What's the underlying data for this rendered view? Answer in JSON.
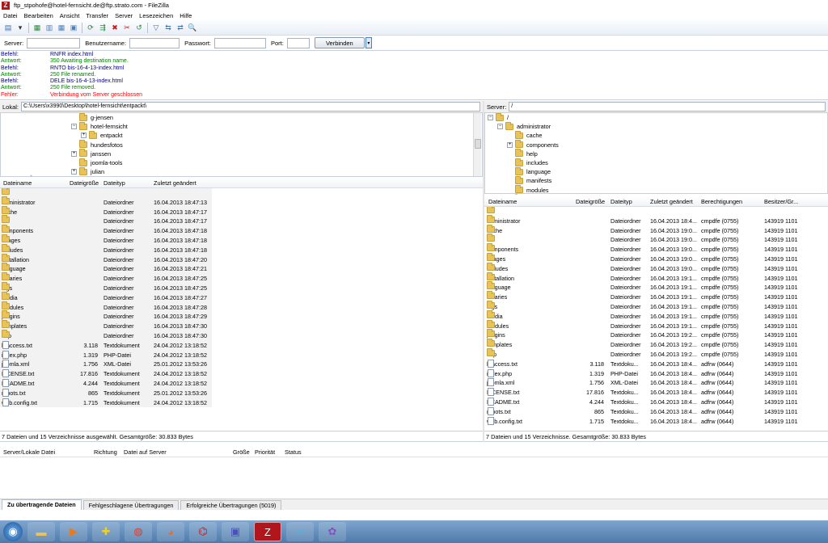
{
  "window": {
    "title": "ftp_stpohofe@hotel-fernsicht.de@ftp.strato.com - FileZilla",
    "logo": "Z"
  },
  "menu": [
    "Datei",
    "Bearbeiten",
    "Ansicht",
    "Transfer",
    "Server",
    "Lesezeichen",
    "Hilfe"
  ],
  "toolbar": {
    "icons": [
      "site-manager-icon",
      "dropdown-icon",
      "toggle-log-icon",
      "toggle-local-tree-icon",
      "toggle-remote-tree-icon",
      "toggle-queue-icon",
      "refresh-icon",
      "process-queue-icon",
      "cancel-icon",
      "disconnect-icon",
      "reconnect-icon",
      "filter-icon",
      "compare-icon",
      "sync-browse-icon",
      "search-icon"
    ],
    "glyphs": [
      "▤",
      "▾",
      "▦",
      "▥",
      "▦",
      "▣",
      "⟳",
      "⇶",
      "✖",
      "✂",
      "↺",
      "▽",
      "⇆",
      "⇄",
      "🔍"
    ]
  },
  "quickconnect": {
    "server_label": "Server:",
    "user_label": "Benutzername:",
    "pass_label": "Passwort:",
    "port_label": "Port:",
    "button": "Verbinden",
    "drop": "▾"
  },
  "log": [
    {
      "k": "Befehl:",
      "v": "RNFR index.html",
      "c": "#000080"
    },
    {
      "k": "Antwort:",
      "v": "350 Awaiting destination name.",
      "c": "#008000"
    },
    {
      "k": "Befehl:",
      "v": "RNTO bis-16-4-13-index.html",
      "c": "#000080"
    },
    {
      "k": "Antwort:",
      "v": "250 File renamed.",
      "c": "#008000"
    },
    {
      "k": "Befehl:",
      "v": "DELE bis-16-4-13-index.html",
      "c": "#000080"
    },
    {
      "k": "Antwort:",
      "v": "250 File removed.",
      "c": "#008000"
    },
    {
      "k": "Fehler:",
      "v": "Verbindung vom Server geschlossen",
      "c": "#ff0000"
    }
  ],
  "local": {
    "label": "Lokal:",
    "path": "C:\\Users\\x3990\\Desktop\\hotel-fernsicht\\entpackt\\",
    "tree": [
      {
        "name": "g-jensen",
        "indent": 1,
        "exp": ""
      },
      {
        "name": "hotel-fernsicht",
        "indent": 1,
        "exp": "−"
      },
      {
        "name": "entpackt",
        "indent": 2,
        "exp": "+"
      },
      {
        "name": "hundesfotos",
        "indent": 1,
        "exp": ""
      },
      {
        "name": "janssen",
        "indent": 1,
        "exp": "+"
      },
      {
        "name": "joomla-tools",
        "indent": 1,
        "exp": ""
      },
      {
        "name": "julian",
        "indent": 1,
        "exp": "+"
      }
    ],
    "columns": [
      "Dateiname",
      "Dateigröße",
      "Dateityp",
      "Zuletzt geändert"
    ],
    "rows": [
      {
        "name": "..",
        "size": "",
        "type": "",
        "date": "",
        "kind": "folder"
      },
      {
        "name": "administrator",
        "size": "",
        "type": "Dateiordner",
        "date": "16.04.2013 18:47:13",
        "kind": "folder"
      },
      {
        "name": "cache",
        "size": "",
        "type": "Dateiordner",
        "date": "16.04.2013 18:47:17",
        "kind": "folder"
      },
      {
        "name": "cli",
        "size": "",
        "type": "Dateiordner",
        "date": "16.04.2013 18:47:17",
        "kind": "folder"
      },
      {
        "name": "components",
        "size": "",
        "type": "Dateiordner",
        "date": "16.04.2013 18:47:18",
        "kind": "folder"
      },
      {
        "name": "images",
        "size": "",
        "type": "Dateiordner",
        "date": "16.04.2013 18:47:18",
        "kind": "folder"
      },
      {
        "name": "includes",
        "size": "",
        "type": "Dateiordner",
        "date": "16.04.2013 18:47:18",
        "kind": "folder"
      },
      {
        "name": "installation",
        "size": "",
        "type": "Dateiordner",
        "date": "16.04.2013 18:47:20",
        "kind": "folder"
      },
      {
        "name": "language",
        "size": "",
        "type": "Dateiordner",
        "date": "16.04.2013 18:47:21",
        "kind": "folder"
      },
      {
        "name": "libraries",
        "size": "",
        "type": "Dateiordner",
        "date": "16.04.2013 18:47:25",
        "kind": "folder"
      },
      {
        "name": "logs",
        "size": "",
        "type": "Dateiordner",
        "date": "16.04.2013 18:47:25",
        "kind": "folder"
      },
      {
        "name": "media",
        "size": "",
        "type": "Dateiordner",
        "date": "16.04.2013 18:47:27",
        "kind": "folder"
      },
      {
        "name": "modules",
        "size": "",
        "type": "Dateiordner",
        "date": "16.04.2013 18:47:28",
        "kind": "folder"
      },
      {
        "name": "plugins",
        "size": "",
        "type": "Dateiordner",
        "date": "16.04.2013 18:47:29",
        "kind": "folder"
      },
      {
        "name": "templates",
        "size": "",
        "type": "Dateiordner",
        "date": "16.04.2013 18:47:30",
        "kind": "folder"
      },
      {
        "name": "tmp",
        "size": "",
        "type": "Dateiordner",
        "date": "16.04.2013 18:47:30",
        "kind": "folder"
      },
      {
        "name": "htaccess.txt",
        "size": "3.118",
        "type": "Textdokument",
        "date": "24.04.2012 13:18:52",
        "kind": "file"
      },
      {
        "name": "index.php",
        "size": "1.319",
        "type": "PHP-Datei",
        "date": "24.04.2012 13:18:52",
        "kind": "file"
      },
      {
        "name": "joomla.xml",
        "size": "1.756",
        "type": "XML-Datei",
        "date": "25.01.2012 13:53:26",
        "kind": "file"
      },
      {
        "name": "LICENSE.txt",
        "size": "17.816",
        "type": "Textdokument",
        "date": "24.04.2012 13:18:52",
        "kind": "file"
      },
      {
        "name": "README.txt",
        "size": "4.244",
        "type": "Textdokument",
        "date": "24.04.2012 13:18:52",
        "kind": "file"
      },
      {
        "name": "robots.txt",
        "size": "865",
        "type": "Textdokument",
        "date": "25.01.2012 13:53:26",
        "kind": "file"
      },
      {
        "name": "web.config.txt",
        "size": "1.715",
        "type": "Textdokument",
        "date": "24.04.2012 13:18:52",
        "kind": "file"
      }
    ],
    "status": "7 Dateien und 15 Verzeichnisse ausgewählt. Gesamtgröße: 30.833 Bytes"
  },
  "remote": {
    "label": "Server:",
    "path": "/",
    "tree": [
      {
        "name": "/",
        "indent": 0,
        "exp": "−"
      },
      {
        "name": "administrator",
        "indent": 1,
        "exp": "−"
      },
      {
        "name": "cache",
        "indent": 2,
        "exp": ""
      },
      {
        "name": "components",
        "indent": 2,
        "exp": "+"
      },
      {
        "name": "help",
        "indent": 2,
        "exp": ""
      },
      {
        "name": "includes",
        "indent": 2,
        "exp": ""
      },
      {
        "name": "language",
        "indent": 2,
        "exp": ""
      },
      {
        "name": "manifests",
        "indent": 2,
        "exp": ""
      },
      {
        "name": "modules",
        "indent": 2,
        "exp": ""
      }
    ],
    "columns": [
      "Dateiname",
      "Dateigröße",
      "Dateityp",
      "Zuletzt geändert",
      "Berechtigungen",
      "Besitzer/Gr..."
    ],
    "rows": [
      {
        "name": "..",
        "size": "",
        "type": "",
        "date": "",
        "perm": "",
        "owner": "",
        "kind": "folder"
      },
      {
        "name": "administrator",
        "size": "",
        "type": "Dateiordner",
        "date": "16.04.2013 18:4...",
        "perm": "cmpdfe (0755)",
        "owner": "143919 1101",
        "kind": "folder"
      },
      {
        "name": "cache",
        "size": "",
        "type": "Dateiordner",
        "date": "16.04.2013 19:0...",
        "perm": "cmpdfe (0755)",
        "owner": "143919 1101",
        "kind": "folder"
      },
      {
        "name": "cli",
        "size": "",
        "type": "Dateiordner",
        "date": "16.04.2013 19:0...",
        "perm": "cmpdfe (0755)",
        "owner": "143919 1101",
        "kind": "folder"
      },
      {
        "name": "components",
        "size": "",
        "type": "Dateiordner",
        "date": "16.04.2013 19:0...",
        "perm": "cmpdfe (0755)",
        "owner": "143919 1101",
        "kind": "folder"
      },
      {
        "name": "images",
        "size": "",
        "type": "Dateiordner",
        "date": "16.04.2013 19:0...",
        "perm": "cmpdfe (0755)",
        "owner": "143919 1101",
        "kind": "folder"
      },
      {
        "name": "includes",
        "size": "",
        "type": "Dateiordner",
        "date": "16.04.2013 19:0...",
        "perm": "cmpdfe (0755)",
        "owner": "143919 1101",
        "kind": "folder"
      },
      {
        "name": "installation",
        "size": "",
        "type": "Dateiordner",
        "date": "16.04.2013 19:1...",
        "perm": "cmpdfe (0755)",
        "owner": "143919 1101",
        "kind": "folder"
      },
      {
        "name": "language",
        "size": "",
        "type": "Dateiordner",
        "date": "16.04.2013 19:1...",
        "perm": "cmpdfe (0755)",
        "owner": "143919 1101",
        "kind": "folder"
      },
      {
        "name": "libraries",
        "size": "",
        "type": "Dateiordner",
        "date": "16.04.2013 19:1...",
        "perm": "cmpdfe (0755)",
        "owner": "143919 1101",
        "kind": "folder"
      },
      {
        "name": "logs",
        "size": "",
        "type": "Dateiordner",
        "date": "16.04.2013 19:1...",
        "perm": "cmpdfe (0755)",
        "owner": "143919 1101",
        "kind": "folder"
      },
      {
        "name": "media",
        "size": "",
        "type": "Dateiordner",
        "date": "16.04.2013 19:1...",
        "perm": "cmpdfe (0755)",
        "owner": "143919 1101",
        "kind": "folder"
      },
      {
        "name": "modules",
        "size": "",
        "type": "Dateiordner",
        "date": "16.04.2013 19:1...",
        "perm": "cmpdfe (0755)",
        "owner": "143919 1101",
        "kind": "folder"
      },
      {
        "name": "plugins",
        "size": "",
        "type": "Dateiordner",
        "date": "16.04.2013 19:2...",
        "perm": "cmpdfe (0755)",
        "owner": "143919 1101",
        "kind": "folder"
      },
      {
        "name": "templates",
        "size": "",
        "type": "Dateiordner",
        "date": "16.04.2013 19:2...",
        "perm": "cmpdfe (0755)",
        "owner": "143919 1101",
        "kind": "folder"
      },
      {
        "name": "tmp",
        "size": "",
        "type": "Dateiordner",
        "date": "16.04.2013 19:2...",
        "perm": "cmpdfe (0755)",
        "owner": "143919 1101",
        "kind": "folder"
      },
      {
        "name": "htaccess.txt",
        "size": "3.118",
        "type": "Textdoku...",
        "date": "16.04.2013 18:4...",
        "perm": "adfrw (0644)",
        "owner": "143919 1101",
        "kind": "file"
      },
      {
        "name": "index.php",
        "size": "1.319",
        "type": "PHP-Datei",
        "date": "16.04.2013 18:4...",
        "perm": "adfrw (0644)",
        "owner": "143919 1101",
        "kind": "file"
      },
      {
        "name": "joomla.xml",
        "size": "1.756",
        "type": "XML-Datei",
        "date": "16.04.2013 18:4...",
        "perm": "adfrw (0644)",
        "owner": "143919 1101",
        "kind": "file"
      },
      {
        "name": "LICENSE.txt",
        "size": "17.816",
        "type": "Textdoku...",
        "date": "16.04.2013 18:4...",
        "perm": "adfrw (0644)",
        "owner": "143919 1101",
        "kind": "file"
      },
      {
        "name": "README.txt",
        "size": "4.244",
        "type": "Textdoku...",
        "date": "16.04.2013 18:4...",
        "perm": "adfrw (0644)",
        "owner": "143919 1101",
        "kind": "file"
      },
      {
        "name": "robots.txt",
        "size": "865",
        "type": "Textdoku...",
        "date": "16.04.2013 18:4...",
        "perm": "adfrw (0644)",
        "owner": "143919 1101",
        "kind": "file"
      },
      {
        "name": "web.config.txt",
        "size": "1.715",
        "type": "Textdoku...",
        "date": "16.04.2013 18:4...",
        "perm": "adfrw (0644)",
        "owner": "143919 1101",
        "kind": "file"
      }
    ],
    "status": "7 Dateien und 15 Verzeichnisse. Gesamtgröße: 30.833 Bytes"
  },
  "queue": {
    "columns": [
      "Server/Lokale Datei",
      "Richtung",
      "Datei auf Server",
      "Größe",
      "Priorität",
      "Status"
    ],
    "tabs": [
      "Zu übertragende Dateien",
      "Fehlgeschlagene Übertragungen",
      "Erfolgreiche Übertragungen (5019)"
    ]
  },
  "taskbar": [
    {
      "name": "start-button-icon",
      "glyph": "◉",
      "color": "#2a6fbf"
    },
    {
      "name": "explorer-icon",
      "glyph": "▬",
      "color": "#e9c45a"
    },
    {
      "name": "media-player-icon",
      "glyph": "▶",
      "color": "#e87a1e"
    },
    {
      "name": "cross-app-icon",
      "glyph": "✚",
      "color": "#f0d020"
    },
    {
      "name": "chrome-icon",
      "glyph": "◍",
      "color": "#d8412f"
    },
    {
      "name": "firefox-icon",
      "glyph": "◕",
      "color": "#e8701e"
    },
    {
      "name": "acrobat-icon",
      "glyph": "⌬",
      "color": "#c81a1a"
    },
    {
      "name": "save-disk-icon",
      "glyph": "▣",
      "color": "#4a4fc0"
    },
    {
      "name": "filezilla-icon",
      "glyph": "Z",
      "color": "#b0161b"
    },
    {
      "name": "notepad-icon",
      "glyph": "▱",
      "color": "#5ab0d8"
    },
    {
      "name": "picasa-icon",
      "glyph": "✿",
      "color": "#8a4fc0"
    }
  ]
}
